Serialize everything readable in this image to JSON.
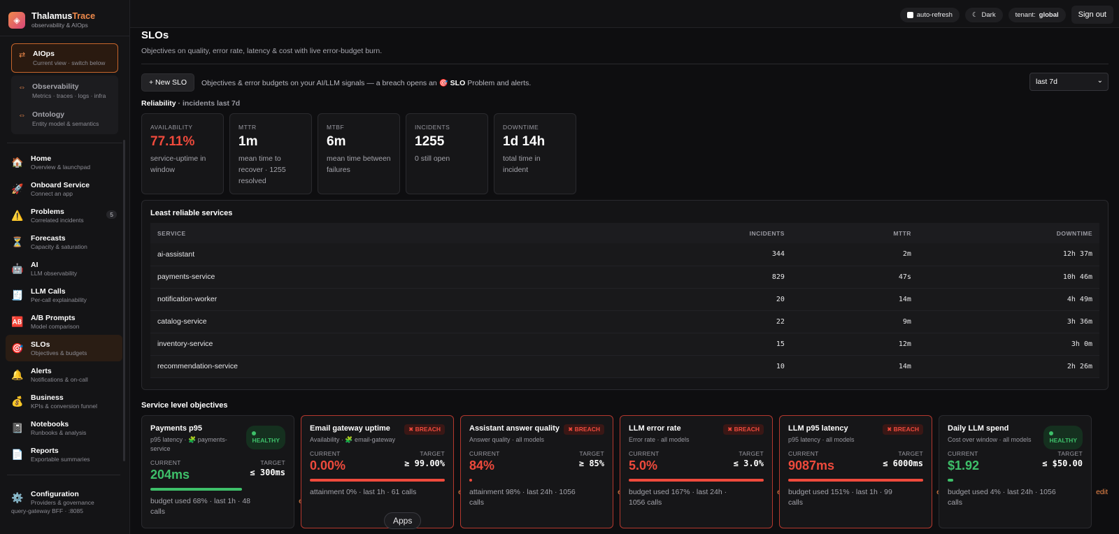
{
  "brand": {
    "name_a": "Thalamus",
    "name_b": "Trace",
    "sub": "observability & AIOps",
    "logo_icon": "◈"
  },
  "switcher": {
    "active": {
      "title": "AIOps",
      "sub": "Current view · switch below",
      "icon": "⇄"
    },
    "others": [
      {
        "title": "Observability",
        "sub": "Metrics · traces · logs · infra",
        "icon": "⇔"
      },
      {
        "title": "Ontology",
        "sub": "Entity model & semantics",
        "icon": "⇔"
      }
    ]
  },
  "nav": [
    {
      "title": "Home",
      "sub": "Overview & launchpad",
      "icon": "🏠"
    },
    {
      "title": "Onboard Service",
      "sub": "Connect an app",
      "icon": "🚀"
    },
    {
      "title": "Problems",
      "sub": "Correlated incidents",
      "icon": "⚠️",
      "badge": "5"
    },
    {
      "title": "Forecasts",
      "sub": "Capacity & saturation",
      "icon": "⏳"
    },
    {
      "title": "AI",
      "sub": "LLM observability",
      "icon": "🤖"
    },
    {
      "title": "LLM Calls",
      "sub": "Per-call explainability",
      "icon": "🧾"
    },
    {
      "title": "A/B Prompts",
      "sub": "Model comparison",
      "icon": "🆎"
    },
    {
      "title": "SLOs",
      "sub": "Objectives & budgets",
      "icon": "🎯",
      "active": true
    },
    {
      "title": "Alerts",
      "sub": "Notifications & on-call",
      "icon": "🔔"
    },
    {
      "title": "Business",
      "sub": "KPIs & conversion funnel",
      "icon": "💰"
    },
    {
      "title": "Notebooks",
      "sub": "Runbooks & analysis",
      "icon": "📓"
    },
    {
      "title": "Reports",
      "sub": "Exportable summaries",
      "icon": "📄"
    }
  ],
  "config": {
    "title": "Configuration",
    "sub": "Providers & governance",
    "icon": "⚙️"
  },
  "footer": "query-gateway BFF · :8085",
  "topbar": {
    "auto_refresh": "auto-refresh",
    "theme": "Dark",
    "theme_icon": "☾",
    "tenant_label": "tenant:",
    "tenant_value": "global",
    "sign_out": "Sign out"
  },
  "page": {
    "title": "SLOs",
    "subtitle": "Objectives on quality, error rate, latency & cost with live error-budget burn.",
    "new_slo": "+ New SLO",
    "toolbar_text_a": "Objectives & error budgets on your AI/LLM signals — a breach opens an 🎯",
    "toolbar_text_b": "SLO",
    "toolbar_text_c": "Problem and alerts.",
    "range": "last 7d"
  },
  "reliability": {
    "title": "Reliability",
    "subtitle": "· incidents last 7d",
    "kpis": [
      {
        "label": "AVAILABILITY",
        "value": "77.11%",
        "sub": "service-uptime in window",
        "red": true
      },
      {
        "label": "MTTR",
        "value": "1m",
        "sub": "mean time to recover · 1255 resolved"
      },
      {
        "label": "MTBF",
        "value": "6m",
        "sub": "mean time between failures"
      },
      {
        "label": "INCIDENTS",
        "value": "1255",
        "sub": "0 still open"
      },
      {
        "label": "DOWNTIME",
        "value": "1d 14h",
        "sub": "total time in incident"
      }
    ]
  },
  "least_reliable": {
    "title": "Least reliable services",
    "columns": [
      "SERVICE",
      "INCIDENTS",
      "MTTR",
      "DOWNTIME"
    ],
    "rows": [
      [
        "ai-assistant",
        "344",
        "2m",
        "12h 37m"
      ],
      [
        "payments-service",
        "829",
        "47s",
        "10h 46m"
      ],
      [
        "notification-worker",
        "20",
        "14m",
        "4h 49m"
      ],
      [
        "catalog-service",
        "22",
        "9m",
        "3h 36m"
      ],
      [
        "inventory-service",
        "15",
        "12m",
        "3h 0m"
      ],
      [
        "recommendation-service",
        "10",
        "14m",
        "2h 26m"
      ]
    ]
  },
  "slo_section": "Service level objectives",
  "slos": [
    {
      "name": "Payments p95",
      "desc": "p95 latency · 🧩 payments-service",
      "status": "HEALTHY",
      "current_label": "CURRENT",
      "current": "204ms",
      "target_label": "TARGET",
      "target": "≤ 300ms",
      "budget_fraction": 0.68,
      "foot": "budget used 68% · last 1h · 48 calls",
      "edit": "edit"
    },
    {
      "name": "Email gateway uptime",
      "desc": "Availability · 🧩 email-gateway",
      "status": "✖ BREACH",
      "current_label": "CURRENT",
      "current": "0.00%",
      "target_label": "TARGET",
      "target": "≥ 99.00%",
      "budget_fraction": 1.0,
      "foot": "attainment 0% · last 1h · 61 calls",
      "edit": "edit"
    },
    {
      "name": "Assistant answer quality",
      "desc": "Answer quality · all models",
      "status": "✖ BREACH",
      "current_label": "CURRENT",
      "current": "84%",
      "target_label": "TARGET",
      "target": "≥ 85%",
      "budget_fraction": 0.02,
      "foot": "attainment 98% · last 24h · 1056 calls",
      "edit": "edit"
    },
    {
      "name": "LLM error rate",
      "desc": "Error rate · all models",
      "status": "✖ BREACH",
      "current_label": "CURRENT",
      "current": "5.0%",
      "target_label": "TARGET",
      "target": "≤ 3.0%",
      "budget_fraction": 1.0,
      "foot": "budget used 167% · last 24h · 1056 calls",
      "edit": "edit"
    },
    {
      "name": "LLM p95 latency",
      "desc": "p95 latency · all models",
      "status": "✖ BREACH",
      "current_label": "CURRENT",
      "current": "9087ms",
      "target_label": "TARGET",
      "target": "≤ 6000ms",
      "budget_fraction": 1.0,
      "foot": "budget used 151% · last 1h · 99 calls",
      "edit": "edit"
    },
    {
      "name": "Daily LLM spend",
      "desc": "Cost over window · all models",
      "status": "HEALTHY",
      "current_label": "CURRENT",
      "current": "$1.92",
      "target_label": "TARGET",
      "target": "≤ $50.00",
      "budget_fraction": 0.04,
      "foot": "budget used 4% · last 24h · 1056 calls",
      "edit": "edit"
    }
  ],
  "apps_tooltip": "Apps"
}
